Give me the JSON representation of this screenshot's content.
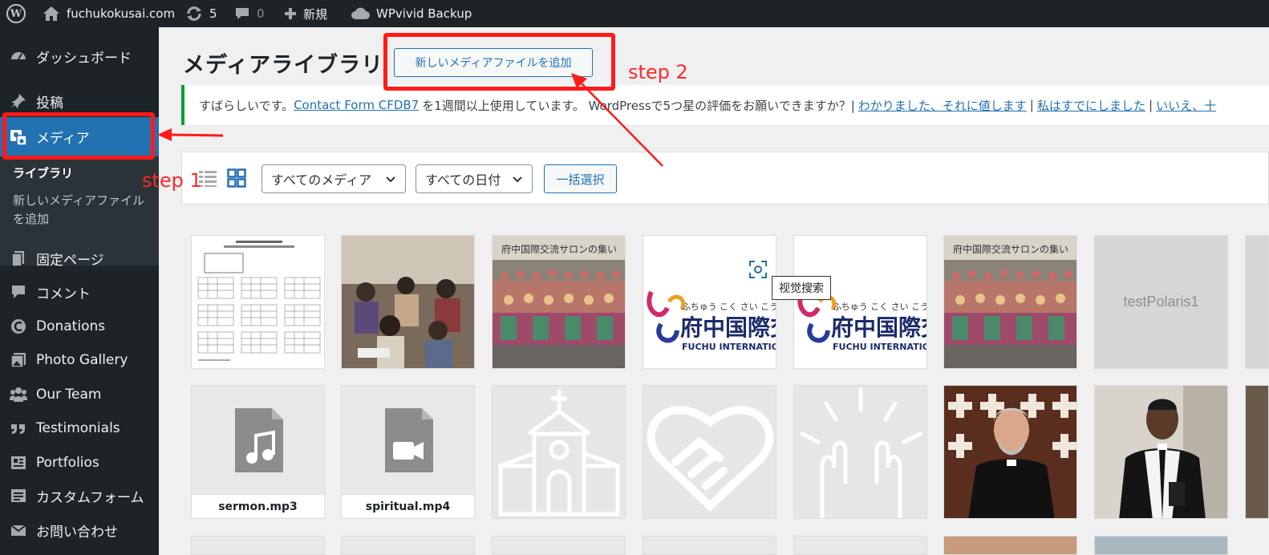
{
  "adminbar": {
    "wp_logo": "W",
    "site_name": "fuchukokusai.com",
    "updates_count": "5",
    "comments_count": "0",
    "new_label": "新規",
    "backup_label": "WPvivid Backup",
    "icons": [
      "wordpress-logo-icon",
      "home-icon",
      "updates-icon",
      "comments-icon",
      "plus-icon",
      "cloud-icon"
    ]
  },
  "sidebar": {
    "items": [
      {
        "label": "ダッシュボード",
        "icon": "dashboard-icon"
      },
      {
        "label": "投稿",
        "icon": "pin-icon"
      },
      {
        "label": "メディア",
        "icon": "media-icon"
      },
      {
        "label": "固定ページ",
        "icon": "page-icon"
      },
      {
        "label": "コメント",
        "icon": "comment-icon"
      },
      {
        "label": "Donations",
        "icon": "donations-icon"
      },
      {
        "label": "Photo Gallery",
        "icon": "gallery-icon"
      },
      {
        "label": "Our Team",
        "icon": "team-icon"
      },
      {
        "label": "Testimonials",
        "icon": "quote-icon"
      },
      {
        "label": "Portfolios",
        "icon": "portfolio-icon"
      },
      {
        "label": "カスタムフォーム",
        "icon": "form-icon"
      },
      {
        "label": "お問い合わせ",
        "icon": "mail-icon"
      }
    ],
    "submenu": {
      "library": "ライブラリ",
      "add_new": "新しいメディアファイルを追加"
    }
  },
  "main": {
    "title": "メディアライブラリ",
    "add_new_button": "新しいメディアファイルを追加",
    "notice": {
      "prefix": "すばらしいです。",
      "plugin_link": "Contact Form CFDB7",
      "middle": "を1週間以上使用しています。 WordPressで5つ星の評価をお願いできますか？|",
      "link1": "わかりました、それに値します",
      "sep": "|",
      "link2": "私はすでにしました",
      "link3": "いいえ、十"
    },
    "toolbar": {
      "filter_media": "すべてのメディア",
      "filter_date": "すべての日付",
      "bulk_select": "一括選択"
    },
    "tiles": [
      {
        "kind": "image",
        "name": "schedule-document-thumb"
      },
      {
        "kind": "image",
        "name": "classroom-photo-thumb"
      },
      {
        "kind": "image",
        "name": "group-photo-thumb"
      },
      {
        "kind": "image",
        "name": "fuchu-logo-thumb"
      },
      {
        "kind": "image",
        "name": "fuchu-logo-thumb-2"
      },
      {
        "kind": "image",
        "name": "group-photo-thumb-2"
      },
      {
        "kind": "text",
        "text": "testPolaris1"
      },
      {
        "kind": "audio",
        "label": "sermon.mp3"
      },
      {
        "kind": "video",
        "label": "spiritual.mp4"
      },
      {
        "kind": "image",
        "name": "church-icon-thumb"
      },
      {
        "kind": "image",
        "name": "heart-hands-thumb"
      },
      {
        "kind": "image",
        "name": "praying-hands-thumb"
      },
      {
        "kind": "image",
        "name": "priest-photo-thumb"
      },
      {
        "kind": "image",
        "name": "pastor-photo-thumb"
      }
    ],
    "logo_text": {
      "kana": "ふちゅう こく さい こう",
      "kanji": "府中国際交",
      "english": "FUCHU INTERNATIONA"
    },
    "group_banner": "府中国際交流サロンの集い",
    "tooltip": "视觉搜索"
  },
  "annotations": {
    "step1": "step 1",
    "step2": "step 2",
    "color": "#ff1a1a"
  }
}
